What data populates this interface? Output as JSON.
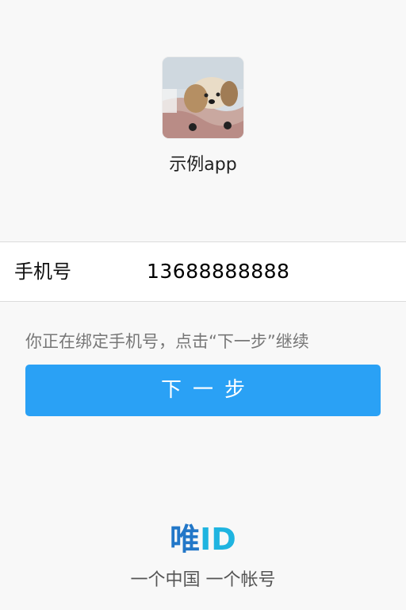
{
  "app": {
    "name": "示例app",
    "logo_icon": "dog-photo-icon"
  },
  "phone_row": {
    "label": "手机号",
    "value": "13688888888"
  },
  "hint": "你正在绑定手机号，点击“下一步”继续",
  "next_button": {
    "label": "下一步",
    "color": "#2aa1f5"
  },
  "footer": {
    "brand_cn": "唯",
    "brand_id": "ID",
    "slogan": "一个中国 一个帐号"
  }
}
